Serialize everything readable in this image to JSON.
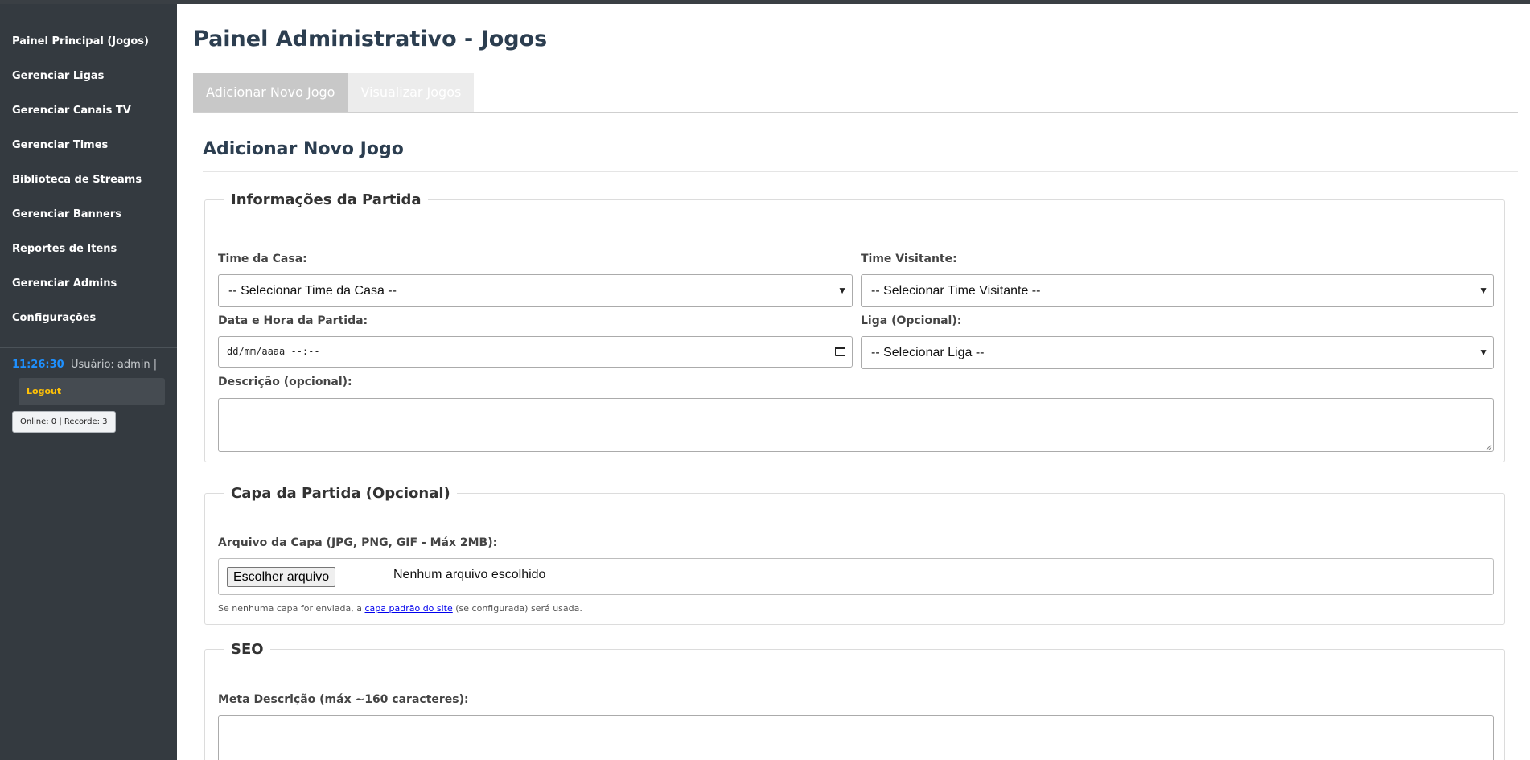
{
  "sidebar": {
    "items": [
      {
        "label": "Painel Principal (Jogos)"
      },
      {
        "label": "Gerenciar Ligas"
      },
      {
        "label": "Gerenciar Canais TV"
      },
      {
        "label": "Gerenciar Times"
      },
      {
        "label": "Biblioteca de Streams"
      },
      {
        "label": "Gerenciar Banners"
      },
      {
        "label": "Reportes de Itens"
      },
      {
        "label": "Gerenciar Admins"
      },
      {
        "label": "Configurações"
      }
    ],
    "clock": "11:26:30",
    "user_text": "Usuário: admin |",
    "logout_label": "Logout",
    "online_text": "Online: 0 | Recorde: 3"
  },
  "colors": {
    "sidebar_bg": "#343a40",
    "clock": "#1e90ff",
    "logout": "#ffc107",
    "title": "#2c3e50"
  },
  "header": {
    "title": "Painel Administrativo - Jogos"
  },
  "tabs": [
    {
      "label": "Adicionar Novo Jogo",
      "active": true
    },
    {
      "label": "Visualizar Jogos",
      "active": false
    }
  ],
  "form": {
    "title": "Adicionar Novo Jogo",
    "match_info": {
      "legend": "Informações da Partida",
      "home_label": "Time da Casa:",
      "home_value": "-- Selecionar Time da Casa --",
      "away_label": "Time Visitante:",
      "away_value": "-- Selecionar Time Visitante --",
      "datetime_label": "Data e Hora da Partida:",
      "datetime_placeholder": "dd/mm/aaaa --:--",
      "league_label": "Liga (Opcional):",
      "league_value": "-- Selecionar Liga --",
      "desc_label": "Descrição (opcional):",
      "desc_value": ""
    },
    "cover": {
      "legend": "Capa da Partida (Opcional)",
      "file_label": "Arquivo da Capa (JPG, PNG, GIF - Máx 2MB):",
      "file_button": "Escolher arquivo",
      "file_status": "Nenhum arquivo escolhido",
      "hint_before": "Se nenhuma capa for enviada, a ",
      "hint_link": "capa padrão do site",
      "hint_after": " (se configurada) será usada."
    },
    "seo": {
      "legend": "SEO",
      "meta_label": "Meta Descrição (máx ~160 caracteres):",
      "meta_value": ""
    }
  }
}
